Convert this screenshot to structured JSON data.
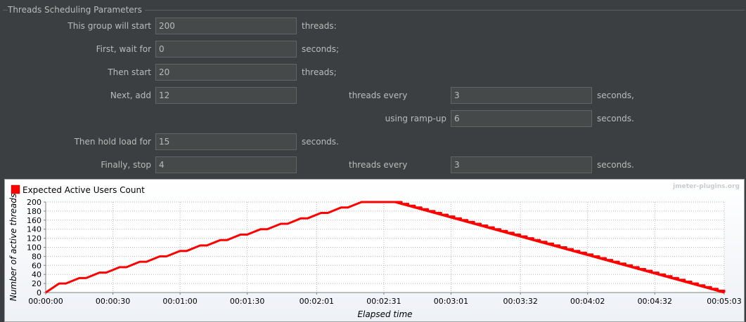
{
  "panel": {
    "title": "Threads Scheduling Parameters"
  },
  "form": {
    "start_label": "This group will start",
    "start_value": "200",
    "start_unit": "threads:",
    "wait_label": "First, wait for",
    "wait_value": "0",
    "wait_unit": "seconds;",
    "then_start_label": "Then start",
    "then_start_value": "20",
    "then_start_unit": "threads;",
    "next_add_label": "Next, add",
    "next_add_value": "12",
    "next_add_every": "threads every",
    "next_add_every_value": "3",
    "next_add_unit": "seconds,",
    "ramp_label": "using ramp-up",
    "ramp_value": "6",
    "ramp_unit": "seconds.",
    "hold_label": "Then hold load for",
    "hold_value": "15",
    "hold_unit": "seconds.",
    "stop_label": "Finally, stop",
    "stop_value": "4",
    "stop_every": "threads every",
    "stop_every_value": "3",
    "stop_unit": "seconds."
  },
  "chart_data": {
    "type": "line",
    "watermark": "jmeter-plugins.org",
    "xlabel": "Elapsed time",
    "ylabel": "Number of active threads",
    "x_unit": "seconds",
    "xlim": [
      0,
      303
    ],
    "ylim": [
      0,
      200
    ],
    "y_ticks": [
      0,
      20,
      40,
      60,
      80,
      100,
      120,
      140,
      160,
      180,
      200
    ],
    "y_tick_labels": [
      "0",
      "20",
      "40",
      "60",
      "80",
      "100",
      "120",
      "140",
      "160",
      "180",
      "200"
    ],
    "x_ticks": [
      0,
      30,
      60,
      90,
      121,
      151,
      181,
      212,
      242,
      272,
      303
    ],
    "x_tick_labels": [
      "00:00:00",
      "00:00:30",
      "00:01:00",
      "00:01:30",
      "00:02:01",
      "00:02:31",
      "00:03:01",
      "00:03:32",
      "00:04:02",
      "00:04:32",
      "00:05:03"
    ],
    "grid": true,
    "legend_position": "top-left",
    "series": [
      {
        "name": "Expected Active Users Count",
        "color": "#ff0000",
        "x": [
          0,
          6,
          9,
          15,
          18,
          24,
          27,
          33,
          36,
          42,
          45,
          51,
          54,
          60,
          63,
          69,
          72,
          78,
          81,
          87,
          90,
          96,
          99,
          105,
          108,
          114,
          117,
          123,
          126,
          132,
          135,
          141,
          144,
          150,
          153,
          156,
          303
        ],
        "y": [
          0,
          20,
          20,
          32,
          32,
          44,
          44,
          56,
          56,
          68,
          68,
          80,
          80,
          92,
          92,
          104,
          104,
          116,
          116,
          128,
          128,
          140,
          140,
          152,
          152,
          164,
          164,
          176,
          176,
          188,
          188,
          200,
          200,
          200,
          200,
          200,
          0
        ]
      }
    ]
  }
}
